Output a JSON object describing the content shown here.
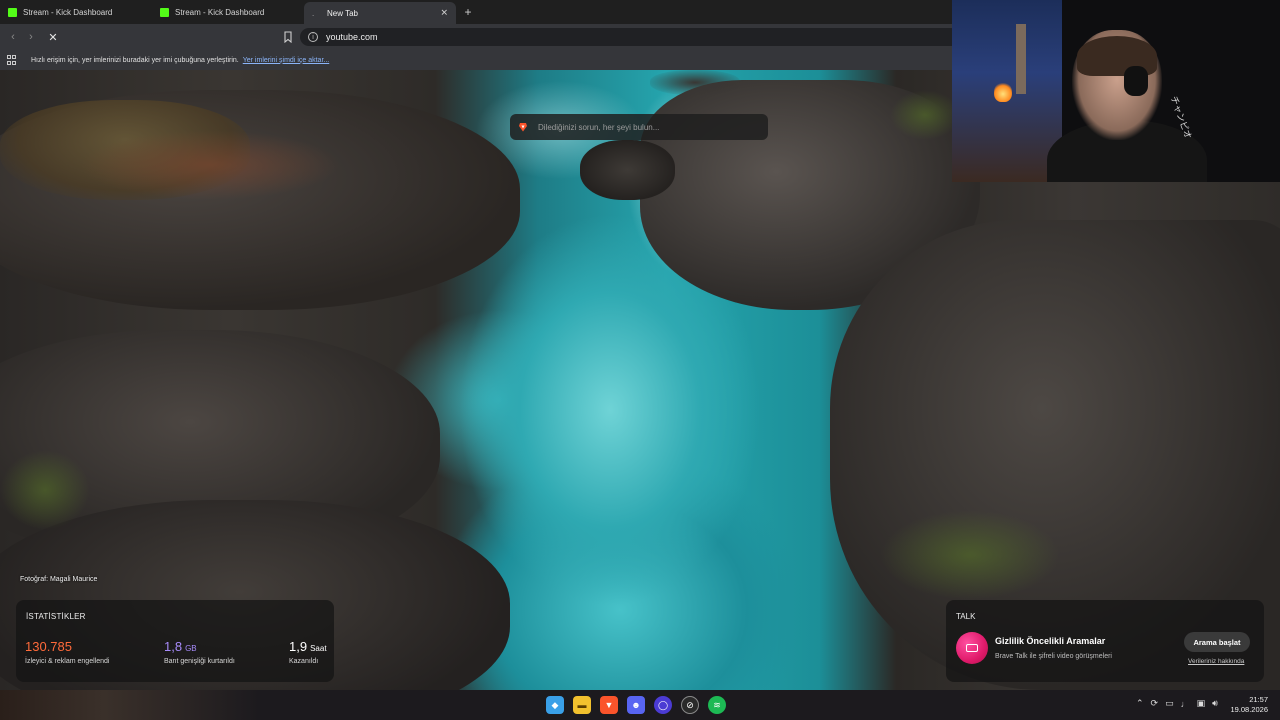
{
  "tabs": [
    {
      "title": "Stream - Kick Dashboard",
      "active": false
    },
    {
      "title": "Stream - Kick Dashboard",
      "active": false
    },
    {
      "title": "New Tab",
      "active": true
    }
  ],
  "omnibox": {
    "url": "youtube.com"
  },
  "bookmarks_bar": {
    "message": "Hızlı erişim için, yer imlerinizi buradaki yer imi çubuğuna yerleştirin.",
    "link": "Yer imlerini şimdi içe aktar..."
  },
  "search": {
    "placeholder": "Dilediğinizi sorun, her şeyi bulun..."
  },
  "photo_credit": "Fotoğraf: Magali Maurice",
  "stats": {
    "heading": "İSTATİSTİKLER",
    "items": [
      {
        "value": "130.785",
        "unit": "",
        "label": "İzleyici & reklam engellendi",
        "color": "#ff6a3a"
      },
      {
        "value": "1,8",
        "unit": "GB",
        "label": "Bant genişliği kurtarıldı",
        "color": "#a78bfa"
      },
      {
        "value": "1,9",
        "unit": "Saat",
        "label": "Kazanıldı",
        "color": "#ffffff"
      }
    ]
  },
  "talk": {
    "heading": "TALK",
    "title": "Gizlilik Öncelikli Aramalar",
    "subtitle": "Brave Talk ile şifreli video görüşmeleri",
    "button": "Arama başlat",
    "link": "Verileriniz hakkında"
  },
  "webcam": {
    "overlay_text": "チャンピオ"
  },
  "taskbar": {
    "apps": [
      "windows-search-icon",
      "file-explorer-icon",
      "brave-browser-icon",
      "discord-icon",
      "obs-icon",
      "app-icon",
      "spotify-icon"
    ],
    "clock_time": "21:57",
    "clock_date": "19.08.2026"
  },
  "colors": {
    "kick_green": "#53fc18",
    "brave_orange": "#fb542b",
    "talk_pink": "#e01a6a"
  }
}
